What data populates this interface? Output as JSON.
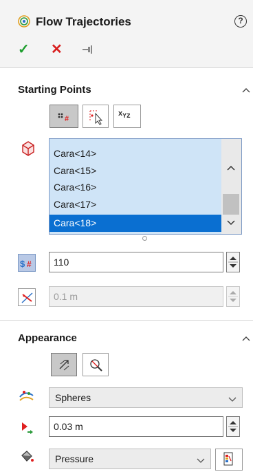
{
  "header": {
    "title": "Flow Trajectories",
    "help_symbol": "?",
    "ok_symbol": "✓",
    "cancel_symbol": "✕",
    "pin_symbol": "⊣"
  },
  "starting_points": {
    "title": "Starting Points",
    "xyz_label": "xyz",
    "faces": [
      "Cara<14>",
      "Cara<15>",
      "Cara<16>",
      "Cara<17>",
      "Cara<18>"
    ],
    "selected_face": "Cara<18>",
    "number_of_points": "110",
    "spacing": "0.1 m"
  },
  "appearance": {
    "title": "Appearance",
    "draw_style": "Spheres",
    "sphere_size": "0.03 m",
    "color_by": "Pressure"
  },
  "colors": {
    "ok": "#1e9e2e",
    "cancel": "#d81e1e",
    "selection": "#0a6fd1",
    "list_background": "#cfe4f7",
    "accent_red": "#e02020"
  },
  "icons": {
    "title": "flow-trajectories-icon",
    "help": "help-icon",
    "ok": "check-icon",
    "cancel": "close-icon",
    "pin": "pin-icon",
    "face": "face-selection-icon"
  }
}
